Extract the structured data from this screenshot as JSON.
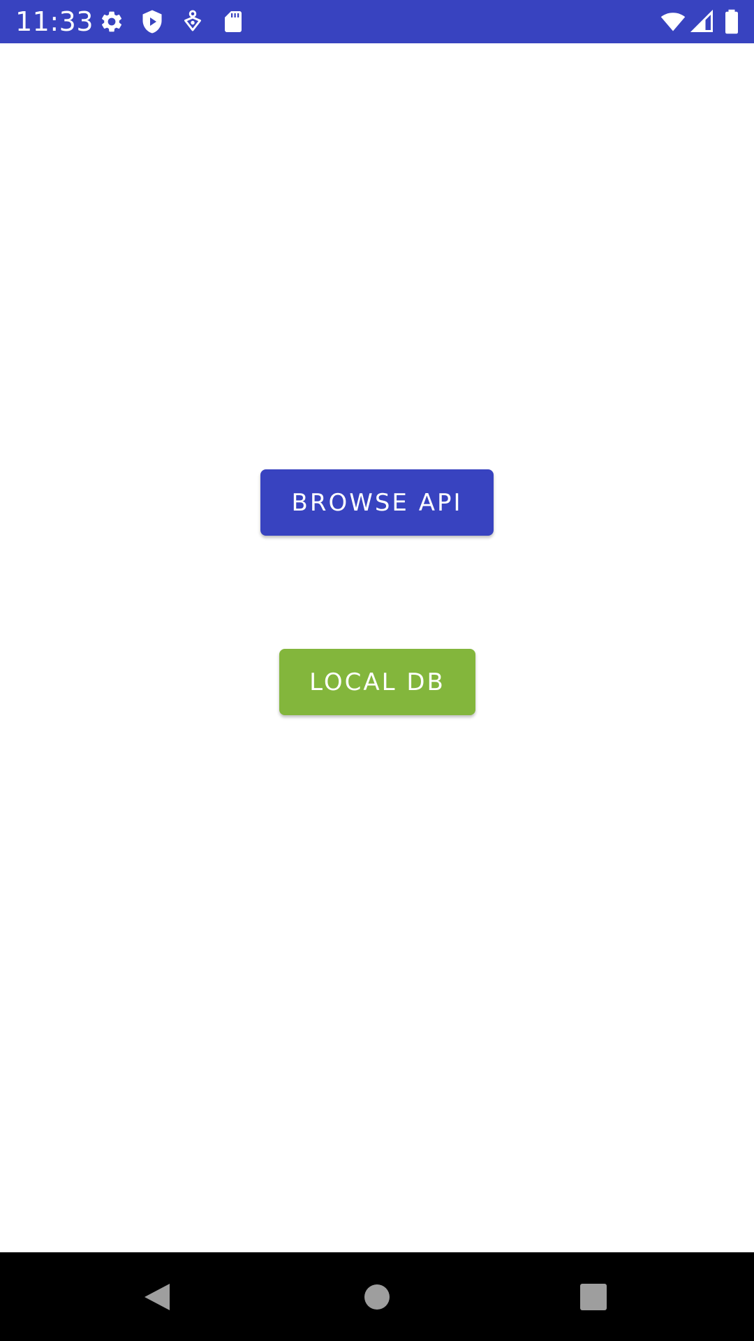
{
  "status_bar": {
    "time": "11:33",
    "background": "#3843c0",
    "left_icons": [
      "gear-icon",
      "shield-play-icon",
      "accessibility-icon",
      "sd-card-icon"
    ],
    "right_icons": [
      "wifi-icon",
      "signal-icon",
      "battery-icon"
    ]
  },
  "main": {
    "browse_button": {
      "label": "BROWSE API",
      "color": "#3843c0"
    },
    "local_button": {
      "label": "LOCAL DB",
      "color": "#83b63c"
    }
  },
  "nav_bar": {
    "items": [
      "back-icon",
      "home-icon",
      "recents-icon"
    ]
  }
}
